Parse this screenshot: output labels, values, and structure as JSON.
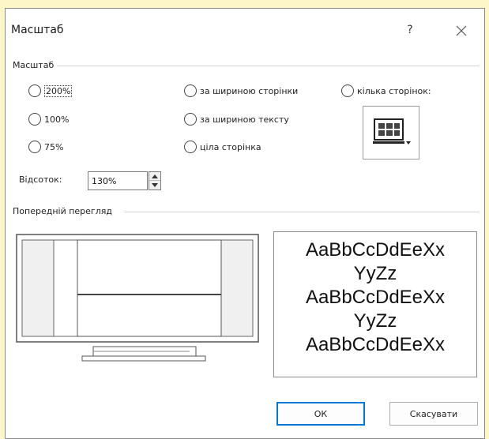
{
  "dialog": {
    "title": "Масштаб",
    "help_label": "?",
    "close_icon": "close-icon"
  },
  "zoom_group": {
    "label": "Масштаб",
    "options": [
      {
        "label": "200%",
        "selected": false
      },
      {
        "label": "100%",
        "selected": false
      },
      {
        "label": "75%",
        "selected": false
      },
      {
        "label": "за шириною сторінки",
        "selected": false
      },
      {
        "label": "за шириною тексту",
        "selected": false
      },
      {
        "label": "ціла сторінка",
        "selected": false
      },
      {
        "label": "кілька сторінок:",
        "selected": false
      }
    ],
    "pages_button_icon": "monitor-pages-icon",
    "percent": {
      "label": "Відсоток:",
      "value": "130%"
    }
  },
  "preview_group": {
    "label": "Попередній перегляд",
    "monitor_icon": "monitor-preview-icon",
    "sample_lines": [
      "AaBbCcDdEeXx",
      "YyZz",
      "AaBbCcDdEeXx",
      "YyZz",
      "AaBbCcDdEeXx"
    ]
  },
  "buttons": {
    "ok_label": "ОК",
    "cancel_label": "Скасувати"
  },
  "colors": {
    "background": "#fdf6c8",
    "dialog": "#ffffff",
    "ok_border": "#0078d7"
  }
}
